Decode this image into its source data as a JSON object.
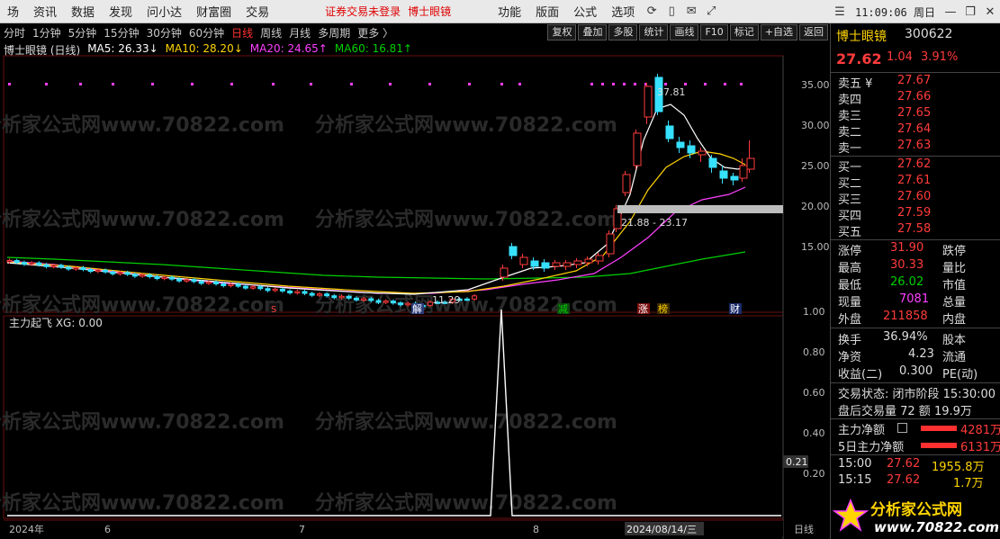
{
  "menu": {
    "items": [
      "场",
      "资讯",
      "数据",
      "发现",
      "问小达",
      "财富圈",
      "交易"
    ],
    "warning": "证券交易未登录",
    "stock_link": "博士眼镜",
    "right_items": [
      "功能",
      "版面",
      "公式",
      "选项"
    ],
    "clock": "11:09:06 周日"
  },
  "periods": [
    "分时",
    "1分钟",
    "5分钟",
    "15分钟",
    "30分钟",
    "60分钟",
    "日线",
    "周线",
    "月线",
    "多周期",
    "更多 〉"
  ],
  "active_period": "日线",
  "toolbar": [
    "复权",
    "叠加",
    "多股",
    "统计",
    "画线",
    "F10",
    "标记",
    "+自选",
    "返回"
  ],
  "chart_title": "博士眼镜 (日线)",
  "ma": [
    {
      "label": "MA5: 26.33↓",
      "color": "#ffffff"
    },
    {
      "label": "MA10: 28.20↓",
      "color": "#ffd400"
    },
    {
      "label": "MA20: 24.65↑",
      "color": "#ff40ff"
    },
    {
      "label": "MA60: 16.81↑",
      "color": "#00d000"
    }
  ],
  "indicator_title": "主力起飞  XG: 0.00",
  "price_axis": [
    "35.00",
    "30.00",
    "25.00",
    "20.00",
    "15.00"
  ],
  "ind_axis": [
    "1.00",
    "0.80",
    "0.60",
    "0.40",
    "0.20"
  ],
  "ind_cursor": "0.21",
  "labels": {
    "high": "37.81",
    "low": "11.29",
    "range": "21.88 - 23.17",
    "date_axis": [
      "2024年",
      "6",
      "7",
      "8"
    ],
    "cursor_date": "2024/08/14/三",
    "day_tag": "日线"
  },
  "event_marks": [
    {
      "t": "S",
      "color": "#ff4040"
    },
    {
      "t": "解",
      "color": "#ffffff"
    },
    {
      "t": "减",
      "color": "#00d000"
    },
    {
      "t": "涨",
      "color": "#ffffff"
    },
    {
      "t": "榜",
      "color": "#ffd400"
    },
    {
      "t": "财",
      "color": "#ffffff"
    }
  ],
  "quote": {
    "name": "博士眼镜",
    "code": "300622",
    "price": "27.62",
    "change": "1.04",
    "pct": "3.91%",
    "asks": [
      {
        "label": "卖五 ¥",
        "price": "27.67"
      },
      {
        "label": "卖四",
        "price": "27.66"
      },
      {
        "label": "卖三",
        "price": "27.65"
      },
      {
        "label": "卖二",
        "price": "27.64"
      },
      {
        "label": "卖一",
        "price": "27.63"
      }
    ],
    "bids": [
      {
        "label": "买一",
        "price": "27.62"
      },
      {
        "label": "买二",
        "price": "27.61"
      },
      {
        "label": "买三",
        "price": "27.60"
      },
      {
        "label": "买四",
        "price": "27.59"
      },
      {
        "label": "买五",
        "price": "27.58"
      }
    ],
    "stats": [
      {
        "k1": "涨停",
        "v1": "31.90",
        "c1": "red",
        "k2": "跌停"
      },
      {
        "k1": "最高",
        "v1": "30.33",
        "c1": "red",
        "k2": "量比"
      },
      {
        "k1": "最低",
        "v1": "26.02",
        "c1": "green",
        "k2": "市值"
      },
      {
        "k1": "现量",
        "v1": "7081",
        "c1": "magenta",
        "k2": "总量"
      },
      {
        "k1": "外盘",
        "v1": "211858",
        "c1": "red",
        "k2": "内盘"
      }
    ],
    "fin": [
      {
        "k1": "换手",
        "v1": "36.94%",
        "k2": "股本"
      },
      {
        "k1": "净资",
        "v1": "4.23",
        "k2": "流通"
      },
      {
        "k1": "收益(二)",
        "v1": "0.300",
        "k2": "PE(动)"
      }
    ],
    "status_line": "交易状态: 闭市阶段 15:30:00",
    "after_line": "盘后交易量 72 额 19.9万",
    "flow": [
      {
        "label": "主力净额",
        "value": "4281万"
      },
      {
        "label": "5日主力净额",
        "value": "6131万"
      }
    ],
    "ticks": [
      {
        "time": "15:00",
        "price": "27.62",
        "vol": "1955.8万"
      },
      {
        "time": "15:15",
        "price": "27.62",
        "vol": "1.7万"
      }
    ]
  },
  "watermark": "分析家公式网www.70822.com",
  "logo": {
    "title": "分析家公式网",
    "url": "www.70822.com"
  },
  "colors": {
    "up": "#ff3b3b",
    "down": "#36e0ff",
    "ma5": "#ffffff",
    "ma10": "#ffd400",
    "ma20": "#ff40ff",
    "ma60": "#00d000"
  }
}
